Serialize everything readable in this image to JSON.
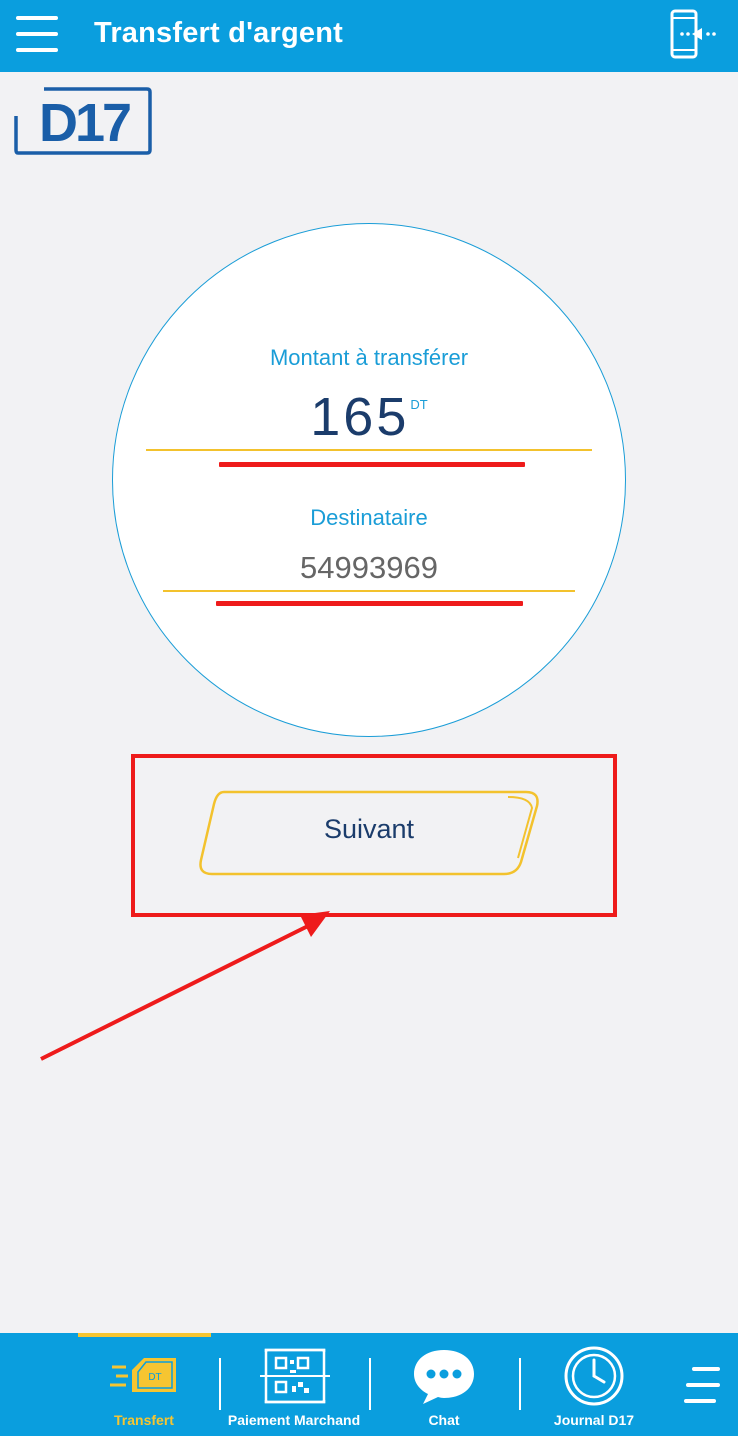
{
  "header": {
    "title": "Transfert d'argent",
    "menu_icon": "hamburger-menu-icon",
    "right_icon": "phone-transfer-icon"
  },
  "logo": {
    "text": "D17",
    "color": "#1a5ea8"
  },
  "form": {
    "amount_label": "Montant à transférer",
    "amount_value": "165",
    "currency": "DT",
    "recipient_label": "Destinataire",
    "recipient_value": "54993969"
  },
  "actions": {
    "next_label": "Suivant"
  },
  "tabs": [
    {
      "label": "Transfert",
      "icon": "transfer-icon",
      "active": true
    },
    {
      "label": "Paiement Marchand",
      "icon": "qr-code-icon",
      "active": false
    },
    {
      "label": "Chat",
      "icon": "chat-bubble-icon",
      "active": false
    },
    {
      "label": "Journal D17",
      "icon": "clock-icon",
      "active": false
    }
  ],
  "colors": {
    "primary": "#0a9ede",
    "accent_yellow": "#f6c531",
    "annotation_red": "#ee1b1b",
    "text_dark_blue": "#1b3c6b"
  }
}
